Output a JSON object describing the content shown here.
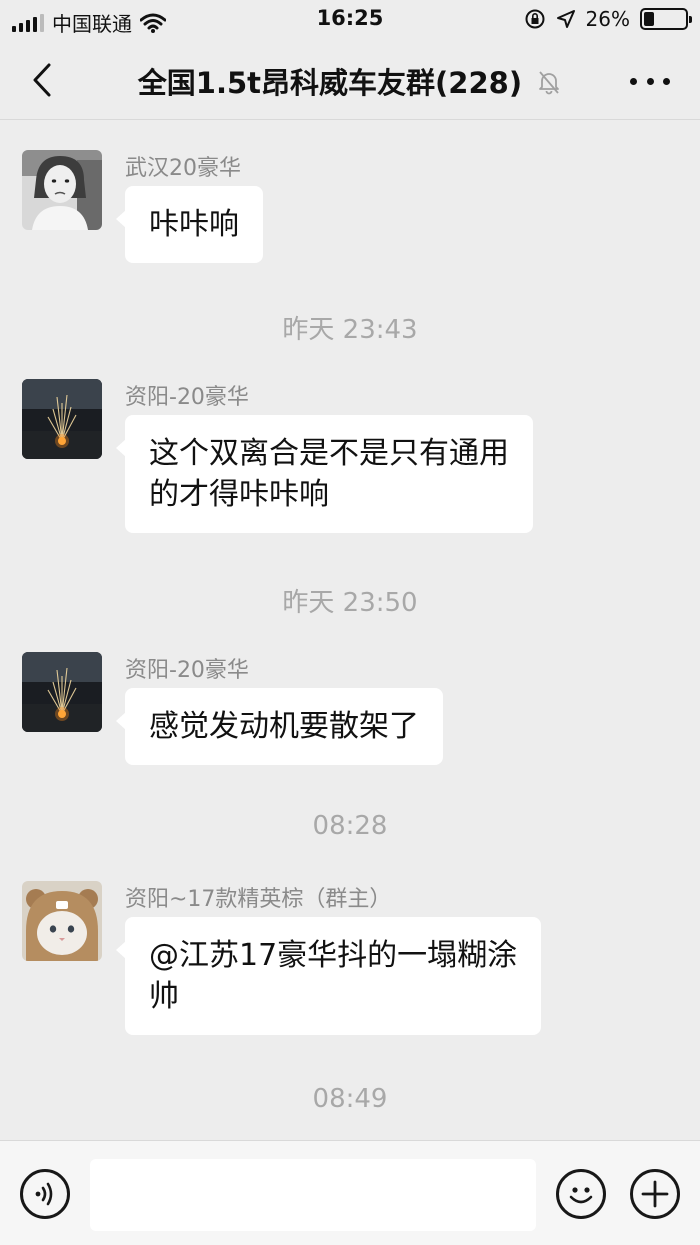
{
  "status_bar": {
    "carrier": "中国联通",
    "time": "16:25",
    "battery_percent": "26%",
    "battery_level": 0.26
  },
  "nav": {
    "title": "全国1.5t昂科威车友群(228)",
    "back_icon": "chevron-left-icon",
    "mute_icon": "bell-muted-icon",
    "more_icon": "more-dots-icon"
  },
  "chat": {
    "messages": [
      {
        "sender": "武汉20豪华",
        "text": "咔咔响",
        "avatar": "girl-photo"
      },
      {
        "sender": "资阳-20豪华",
        "text": "这个双离合是不是只有通用\n的才得咔咔响",
        "avatar": "fireworks-photo"
      },
      {
        "sender": "资阳-20豪华",
        "text": "感觉发动机要散架了",
        "avatar": "fireworks-photo"
      },
      {
        "sender": "资阳~17款精英棕（群主）",
        "text": "@江苏17豪华抖的一塌糊涂\n帅",
        "avatar": "cat-bear-hat-photo"
      }
    ],
    "timestamps": [
      "昨天 23:43",
      "昨天 23:50",
      "08:28",
      "08:49"
    ]
  },
  "input_bar": {
    "voice_icon": "voice-icon",
    "emoji_icon": "emoji-icon",
    "plus_icon": "plus-icon",
    "input_value": ""
  },
  "colors": {
    "background": "#ededed",
    "bubble": "#ffffff",
    "timestamp": "#a8a8a8",
    "sender": "#8a8a8a"
  }
}
